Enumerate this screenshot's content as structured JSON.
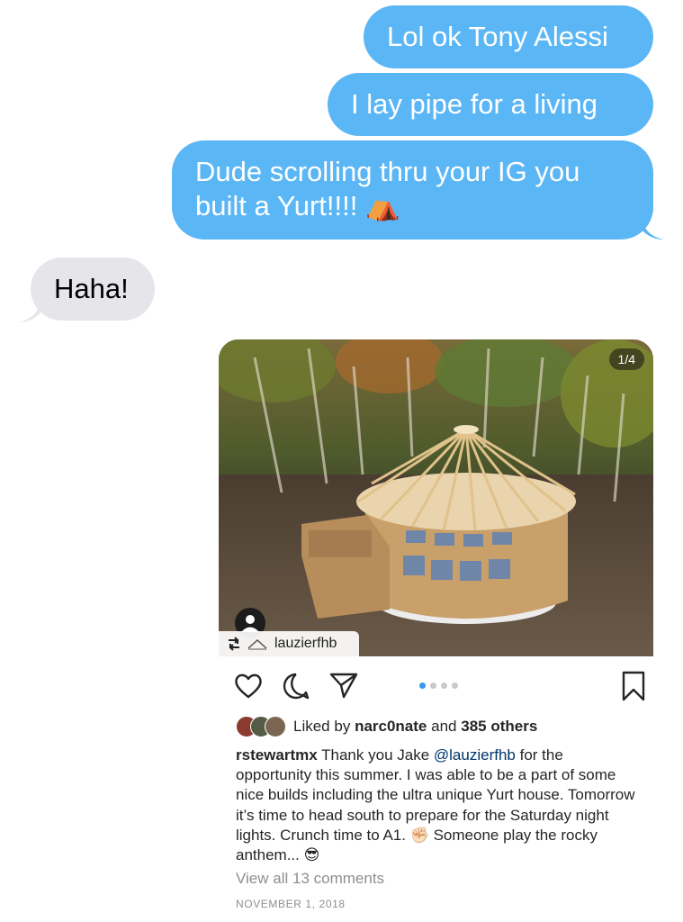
{
  "messages": {
    "out1": "Lol ok Tony Alessi",
    "out2": "I lay pipe for a living",
    "out3_line1": "Dude scrolling thru your IG you",
    "out3_line2": "built a Yurt!!!! ⛺",
    "in1": "Haha!"
  },
  "post": {
    "image_counter": "1/4",
    "repost_user": "lauzierfhb",
    "carousel_dots": 4,
    "active_dot": 0,
    "liked_by_prefix": "Liked by",
    "liked_by_user": "narc0nate",
    "liked_by_and": "and",
    "liked_by_others": "385 others",
    "caption_user": "rstewartmx",
    "caption_part1": "Thank you Jake",
    "caption_mention": "@lauzierfhb",
    "caption_part2": "for the opportunity this summer. I was able to be a part of some nice builds including the ultra unique Yurt house. Tomorrow it’s time to head south to prepare for the Saturday night lights. Crunch time to A1. ✊🏻 Someone play the rocky anthem... 😎",
    "view_all_comments": "View all 13 comments",
    "date": "NOVEMBER 1, 2018"
  },
  "colors": {
    "outgoing_bubble": "#5bb6f5",
    "incoming_bubble": "#e6e5ea",
    "mention": "#003569",
    "active_dot": "#3897f0"
  },
  "icons": [
    "heart-icon",
    "comment-icon",
    "share-icon",
    "bookmark-icon",
    "repost-icon",
    "profile-icon",
    "tent-emoji"
  ]
}
